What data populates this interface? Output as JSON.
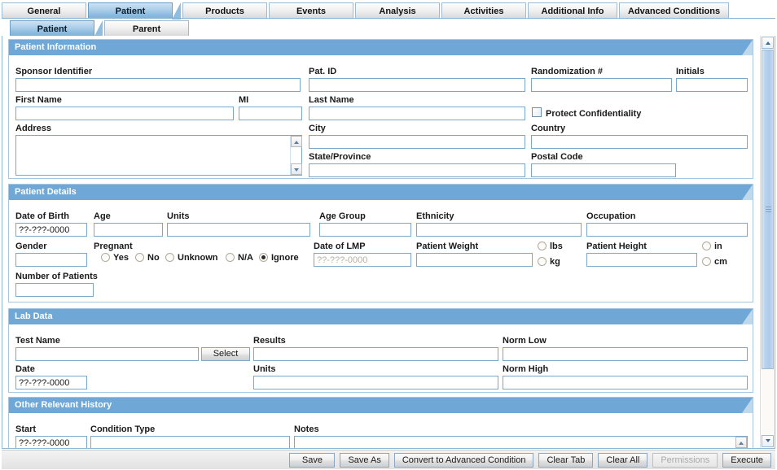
{
  "tabs_primary": [
    {
      "label": "General",
      "selected": false
    },
    {
      "label": "Patient",
      "selected": true
    },
    {
      "label": "Products",
      "selected": false
    },
    {
      "label": "Events",
      "selected": false
    },
    {
      "label": "Analysis",
      "selected": false
    },
    {
      "label": "Activities",
      "selected": false
    },
    {
      "label": "Additional Info",
      "selected": false
    },
    {
      "label": "Advanced Conditions",
      "selected": false
    }
  ],
  "tabs_secondary": [
    {
      "label": "Patient",
      "selected": true
    },
    {
      "label": "Parent",
      "selected": false
    }
  ],
  "sections": {
    "patient_information": {
      "title": "Patient Information",
      "labels": {
        "sponsor_identifier": "Sponsor Identifier",
        "pat_id": "Pat. ID",
        "randomization": "Randomization #",
        "initials": "Initials",
        "first_name": "First Name",
        "mi": "MI",
        "last_name": "Last Name",
        "protect_confidentiality": "Protect Confidentiality",
        "address": "Address",
        "city": "City",
        "country": "Country",
        "state_province": "State/Province",
        "postal_code": "Postal Code"
      },
      "values": {
        "sponsor_identifier": "",
        "pat_id": "",
        "randomization": "",
        "initials": "",
        "first_name": "",
        "mi": "",
        "last_name": "",
        "address": "",
        "city": "",
        "country": "",
        "state_province": "",
        "postal_code": ""
      },
      "protect_confidentiality_checked": false
    },
    "patient_details": {
      "title": "Patient Details",
      "labels": {
        "date_of_birth": "Date of Birth",
        "age": "Age",
        "units": "Units",
        "age_group": "Age Group",
        "ethnicity": "Ethnicity",
        "occupation": "Occupation",
        "gender": "Gender",
        "pregnant": "Pregnant",
        "date_of_lmp": "Date of LMP",
        "patient_weight": "Patient Weight",
        "patient_height": "Patient Height",
        "number_of_patients": "Number of Patients"
      },
      "values": {
        "date_of_birth": "??-???-0000",
        "age": "",
        "units": "",
        "age_group": "",
        "ethnicity": "",
        "occupation": "",
        "gender": "",
        "date_of_lmp": "??-???-0000",
        "patient_weight": "",
        "patient_height": "",
        "number_of_patients": ""
      },
      "pregnant_options": [
        {
          "label": "Yes",
          "selected": false
        },
        {
          "label": "No",
          "selected": false
        },
        {
          "label": "Unknown",
          "selected": false
        },
        {
          "label": "N/A",
          "selected": false
        },
        {
          "label": "Ignore",
          "selected": true
        }
      ],
      "weight_units": [
        {
          "label": "lbs",
          "selected": false
        },
        {
          "label": "kg",
          "selected": false
        }
      ],
      "height_units": [
        {
          "label": "in",
          "selected": false
        },
        {
          "label": "cm",
          "selected": false
        }
      ]
    },
    "lab_data": {
      "title": "Lab Data",
      "labels": {
        "test_name": "Test Name",
        "results": "Results",
        "norm_low": "Norm Low",
        "date": "Date",
        "units": "Units",
        "norm_high": "Norm High"
      },
      "values": {
        "test_name": "",
        "results": "",
        "norm_low": "",
        "date": "??-???-0000",
        "units": "",
        "norm_high": ""
      },
      "select_button": "Select"
    },
    "other_relevant_history": {
      "title": "Other Relevant History",
      "labels": {
        "start": "Start",
        "condition_type": "Condition Type",
        "notes": "Notes"
      },
      "values": {
        "start": "??-???-0000",
        "condition_type": "",
        "notes": ""
      }
    }
  },
  "footer_buttons": [
    {
      "label": "Save",
      "disabled": false
    },
    {
      "label": "Save As",
      "disabled": false
    },
    {
      "label": "Convert to Advanced Condition",
      "disabled": false
    },
    {
      "label": "Clear Tab",
      "disabled": false
    },
    {
      "label": "Clear All",
      "disabled": false
    },
    {
      "label": "Permissions",
      "disabled": true
    },
    {
      "label": "Execute",
      "disabled": false
    }
  ],
  "colors": {
    "section_header": "#6fa8d6",
    "field_border": "#7aa8cb",
    "tab_selected": "#a9cde8"
  }
}
